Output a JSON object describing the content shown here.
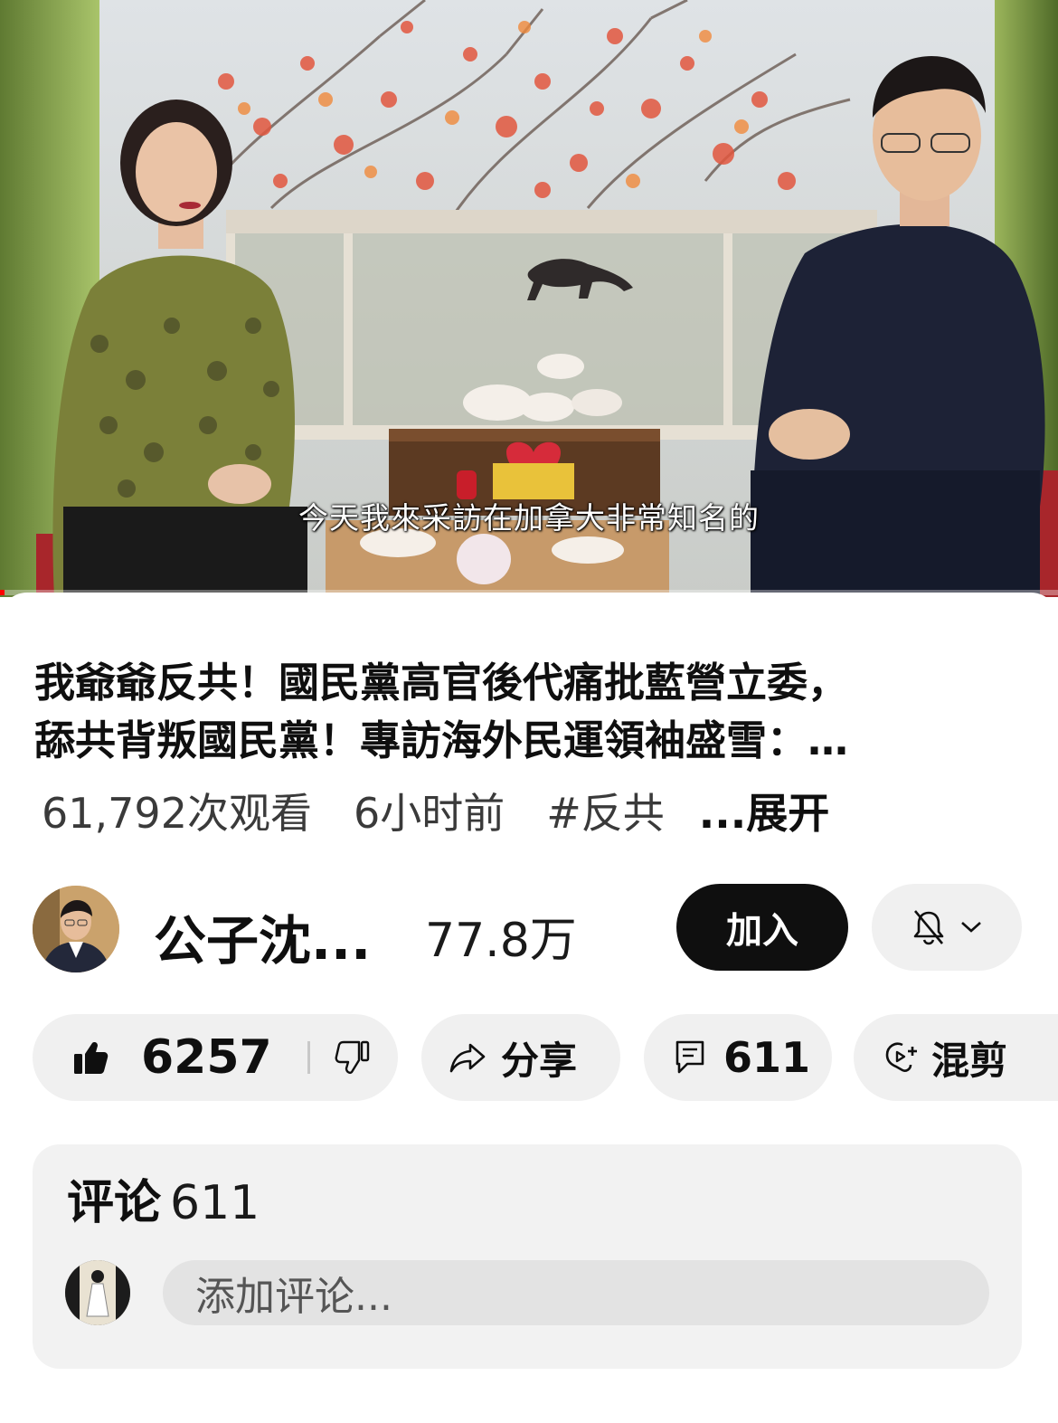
{
  "video": {
    "subtitle": "今天我來采訪在加拿大非常知名的",
    "progress": 0.004
  },
  "info": {
    "title_line1": "我爺爺反共！國民黨高官後代痛批藍營立委，",
    "title_line2": "舔共背叛國民黨！專訪海外民運領袖盛雪：…",
    "views": "61,792次观看",
    "age": "6小时前",
    "hashtag": "#反共",
    "more": "...展开"
  },
  "channel": {
    "name": "公子沈...",
    "subscribers": "77.8万",
    "join_label": "加入",
    "bell_icon": "bell-off-icon"
  },
  "actions": {
    "likes": "6257",
    "share_label": "分享",
    "comments_count": "611",
    "remix_label": "混剪"
  },
  "comments": {
    "label": "评论",
    "count": "611",
    "placeholder": "添加评论..."
  },
  "colors": {
    "progress": "#ff0000",
    "pill_bg": "#f0f0f0",
    "join_bg": "#0f0f0f"
  }
}
